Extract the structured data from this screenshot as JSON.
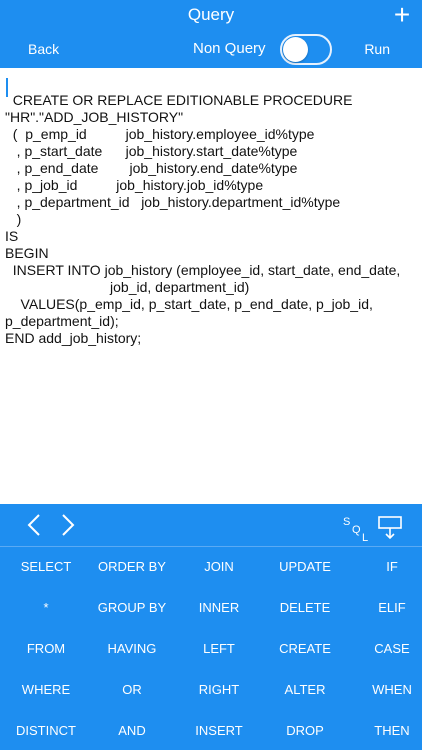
{
  "nav": {
    "title": "Query",
    "back_label": "Back",
    "mode_label": "Non Query",
    "run_label": "Run",
    "plus_icon": "plus-icon",
    "toggle_on": true
  },
  "editor": {
    "code": "  CREATE OR REPLACE EDITIONABLE PROCEDURE\n\"HR\".\"ADD_JOB_HISTORY\"\n  (  p_emp_id          job_history.employee_id%type\n   , p_start_date      job_history.start_date%type\n   , p_end_date        job_history.end_date%type\n   , p_job_id          job_history.job_id%type\n   , p_department_id   job_history.department_id%type\n   )\nIS\nBEGIN\n  INSERT INTO job_history (employee_id, start_date, end_date,\n                           job_id, department_id)\n    VALUES(p_emp_id, p_start_date, p_end_date, p_job_id,\np_department_id);\nEND add_job_history;"
  },
  "accessory": {
    "prev_icon": "chevron-left-icon",
    "next_icon": "chevron-right-icon",
    "sql_icon": "sql-icon",
    "hide_keyboard_icon": "hide-keyboard-icon"
  },
  "keyboard": {
    "rows": [
      [
        "SELECT",
        "ORDER BY",
        "JOIN",
        "UPDATE",
        "IF"
      ],
      [
        "*",
        "GROUP BY",
        "INNER",
        "DELETE",
        "ELIF"
      ],
      [
        "FROM",
        "HAVING",
        "LEFT",
        "CREATE",
        "CASE"
      ],
      [
        "WHERE",
        "OR",
        "RIGHT",
        "ALTER",
        "WHEN"
      ],
      [
        "DISTINCT",
        "AND",
        "INSERT",
        "DROP",
        "THEN"
      ]
    ]
  },
  "colors": {
    "accent": "#1e8ef0",
    "text": "#111111",
    "on_accent": "#ffffff"
  }
}
